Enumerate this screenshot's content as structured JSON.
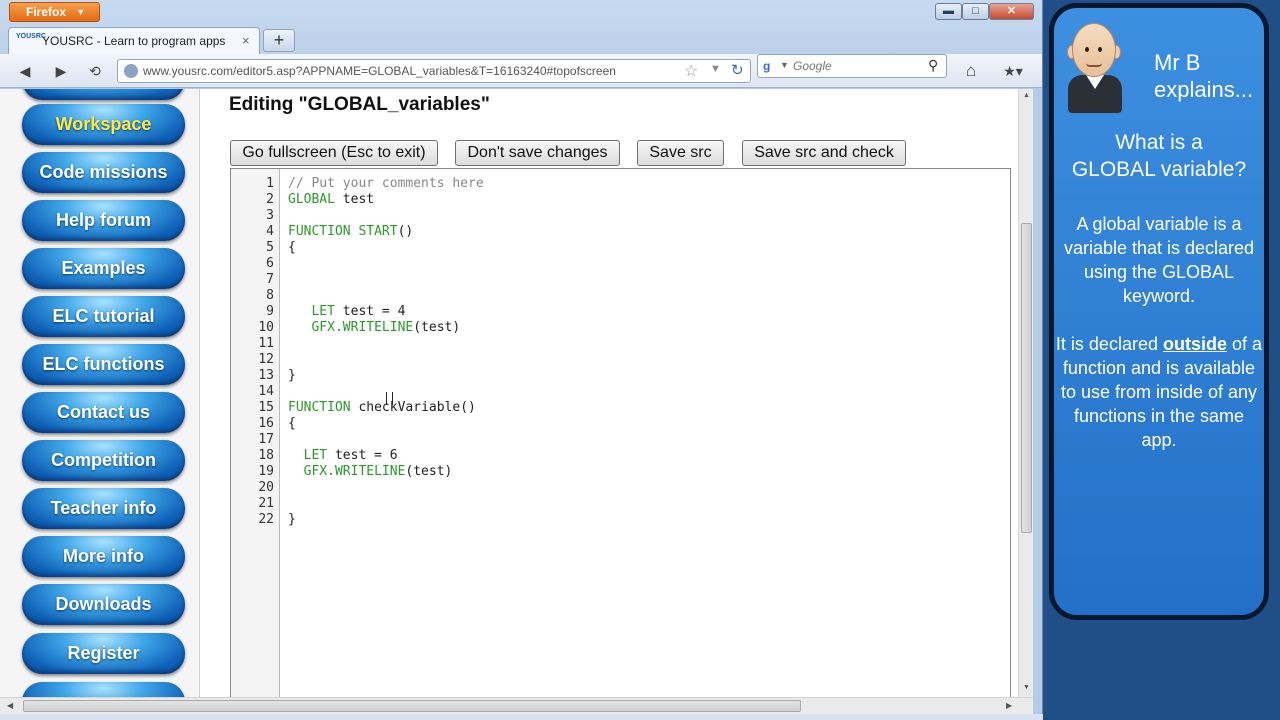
{
  "browser": {
    "app_button": "Firefox",
    "window_controls": {
      "minimize": "▬",
      "maximize": "□",
      "close": "✕"
    },
    "tab": {
      "favicon": "YOUSRC",
      "title": "YOUSRC - Learn to program apps",
      "close": "×"
    },
    "new_tab": "+",
    "nav": {
      "back": "◀",
      "forward": "▶",
      "history": "⟲"
    },
    "url": "www.yousrc.com/editor5.asp?APPNAME=GLOBAL_variables&T=16163240#topofscreen",
    "search": {
      "engine_icon": "g",
      "placeholder": "Google",
      "go_icon": "⚲"
    },
    "home_icon": "⌂",
    "bookmarks_icon": "▾"
  },
  "sidebar": {
    "items": [
      {
        "label": "Workspace",
        "active": true
      },
      {
        "label": "Code missions"
      },
      {
        "label": "Help forum"
      },
      {
        "label": "Examples"
      },
      {
        "label": "ELC tutorial"
      },
      {
        "label": "ELC functions"
      },
      {
        "label": "Contact us"
      },
      {
        "label": "Competition"
      },
      {
        "label": "Teacher info"
      },
      {
        "label": "More info"
      },
      {
        "label": "Downloads"
      },
      {
        "label": "Register"
      }
    ]
  },
  "editor": {
    "title": "Editing \"GLOBAL_variables\"",
    "buttons": {
      "fullscreen": "Go fullscreen (Esc to exit)",
      "dont_save": "Don't save changes",
      "save": "Save src",
      "save_check": "Save src and check"
    },
    "line_numbers": [
      "1",
      "2",
      "3",
      "4",
      "5",
      "6",
      "7",
      "8",
      "9",
      "10",
      "11",
      "12",
      "13",
      "14",
      "15",
      "16",
      "17",
      "18",
      "19",
      "20",
      "21",
      "22"
    ],
    "code": [
      {
        "t": "comment",
        "text": "// Put your comments here"
      },
      {
        "kw": "GLOBAL",
        "rest": " test"
      },
      {
        "text": ""
      },
      {
        "kw": "FUNCTION START",
        "rest": "()"
      },
      {
        "text": "{"
      },
      {
        "text": ""
      },
      {
        "text": ""
      },
      {
        "text": ""
      },
      {
        "pre": "   ",
        "kw": "LET",
        "rest": " test = 4"
      },
      {
        "pre": "   ",
        "kw": "GFX.WRITELINE",
        "rest": "(test)"
      },
      {
        "text": ""
      },
      {
        "text": ""
      },
      {
        "text": "}"
      },
      {
        "text": ""
      },
      {
        "kw": "FUNCTION",
        "rest": " checkVariable()"
      },
      {
        "text": "{"
      },
      {
        "text": ""
      },
      {
        "pre": "  ",
        "kw": "LET",
        "rest": " test = 6"
      },
      {
        "pre": "  ",
        "kw": "GFX.WRITELINE",
        "rest": "(test)"
      },
      {
        "text": ""
      },
      {
        "text": ""
      },
      {
        "text": "}"
      }
    ]
  },
  "explain": {
    "name": "Mr B",
    "explains": "explains...",
    "question_line1": "What is a",
    "question_line2": "GLOBAL variable?",
    "para1": "A global variable is a variable that is declared using the GLOBAL keyword.",
    "para2_start": "It is declared",
    "para2_emph": "outside",
    "para2_end": "of a function and is available to use from inside of any functions in the same app."
  }
}
